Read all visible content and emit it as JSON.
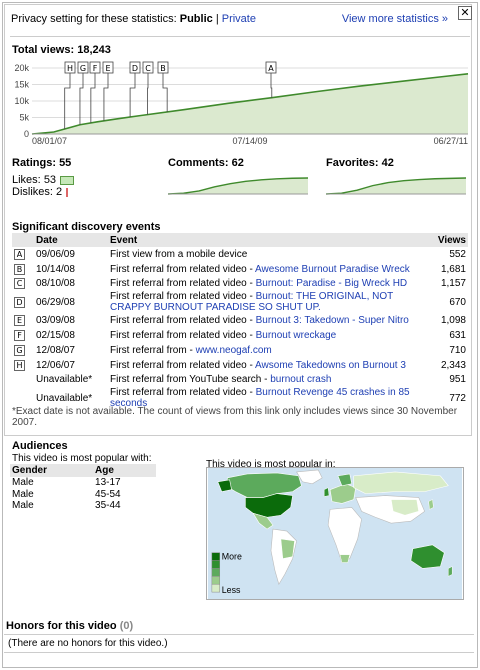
{
  "header": {
    "privacy_prefix": "Privacy setting for these statistics:",
    "privacy_value": "Public",
    "separator": "|",
    "privacy_private": "Private",
    "more_stats": "View more statistics »",
    "close": "✕"
  },
  "total_views": {
    "label": "Total views:",
    "value": "18,243"
  },
  "chart_data": [
    {
      "type": "area",
      "title": "Total views: 18,243",
      "x_tick_labels": [
        "08/01/07",
        "07/14/09",
        "06/27/11"
      ],
      "y_tick_labels": [
        "0",
        "5k",
        "10k",
        "15k",
        "20k"
      ],
      "ylim": [
        0,
        20000
      ],
      "grid": true,
      "x": [
        0,
        0.05,
        0.11,
        0.15,
        0.19,
        0.25,
        0.35,
        0.45,
        0.55,
        0.65,
        0.75,
        0.85,
        0.95,
        1.0
      ],
      "values": [
        0,
        600,
        2800,
        3700,
        4500,
        5600,
        7400,
        9300,
        11000,
        12800,
        14500,
        16000,
        17500,
        18243
      ],
      "markers": [
        "H",
        "G",
        "F",
        "E",
        "D",
        "C",
        "B",
        "A"
      ]
    },
    {
      "type": "line",
      "title": "Comments: 62",
      "values": [
        0,
        3,
        12,
        28,
        40,
        49,
        55,
        59,
        61,
        62
      ]
    },
    {
      "type": "line",
      "title": "Favorites: 42",
      "values": [
        0,
        2,
        10,
        22,
        30,
        35,
        38,
        40,
        41,
        42
      ]
    }
  ],
  "ratings": {
    "label": "Ratings:",
    "value": "55",
    "likes_label": "Likes:",
    "likes": "53",
    "dislikes_label": "Dislikes:",
    "dislikes": "2"
  },
  "comments": {
    "label": "Comments:",
    "value": "62"
  },
  "favorites": {
    "label": "Favorites:",
    "value": "42"
  },
  "events": {
    "title": "Significant discovery events",
    "columns": [
      "Date",
      "Event",
      "Views"
    ],
    "rows": [
      {
        "label": "A",
        "date": "09/06/09",
        "event": "First view from a mobile device",
        "link": "",
        "views": "552"
      },
      {
        "label": "B",
        "date": "10/14/08",
        "event": "First referral from related video - ",
        "link": "Awesome Burnout Paradise Wreck",
        "views": "1,681"
      },
      {
        "label": "C",
        "date": "08/10/08",
        "event": "First referral from related video - ",
        "link": "Burnout: Paradise - Big Wreck HD",
        "views": "1,157"
      },
      {
        "label": "D",
        "date": "06/29/08",
        "event": "First referral from related video - ",
        "link": "Burnout: THE ORIGINAL, NOT CRAPPY BURNOUT PARADISE SO SHUT UP.",
        "views": "670"
      },
      {
        "label": "E",
        "date": "03/09/08",
        "event": "First referral from related video - ",
        "link": "Burnout 3: Takedown - Super Nitro",
        "views": "1,098"
      },
      {
        "label": "F",
        "date": "02/15/08",
        "event": "First referral from related video - ",
        "link": "Burnout wreckage",
        "views": "631"
      },
      {
        "label": "G",
        "date": "12/08/07",
        "event": "First referral from - ",
        "link": "www.neogaf.com",
        "views": "710"
      },
      {
        "label": "H",
        "date": "12/06/07",
        "event": "First referral from related video - ",
        "link": "Awsome Takedowns on Burnout 3",
        "views": "2,343"
      },
      {
        "label": "",
        "date": "Unavailable*",
        "event": "First referral from YouTube search - ",
        "link": "burnout crash",
        "views": "951"
      },
      {
        "label": "",
        "date": "Unavailable*",
        "event": "First referral from related video - ",
        "link": "Burnout Revenge 45 crashes in 85 seconds",
        "views": "772"
      }
    ],
    "footnote": "*Exact date is not available. The count of views from this link only includes views since 30 November 2007."
  },
  "audiences": {
    "title": "Audiences",
    "subtitle": "This video is most popular with:",
    "columns": [
      "Gender",
      "Age"
    ],
    "rows": [
      {
        "gender": "Male",
        "age": "13-17"
      },
      {
        "gender": "Male",
        "age": "45-54"
      },
      {
        "gender": "Male",
        "age": "35-44"
      }
    ],
    "map_label": "This video is most popular in:",
    "legend_more": "More",
    "legend_less": "Less",
    "colors": [
      "#0b6b0b",
      "#2f8f2f",
      "#5caa5c",
      "#9ccc8c",
      "#d8ecc8"
    ]
  },
  "honors": {
    "title": "Honors for this video",
    "count": "(0)",
    "empty": "(There are no honors for this video.)"
  }
}
